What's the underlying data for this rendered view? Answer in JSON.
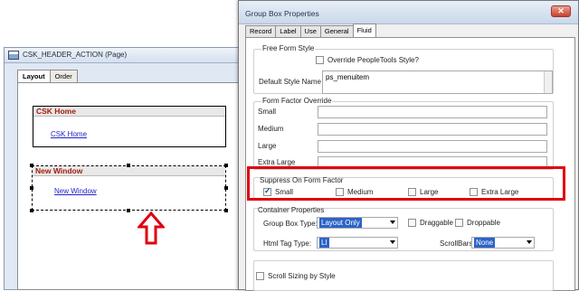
{
  "page_window": {
    "title": "CSK_HEADER_ACTION (Page)",
    "tabs": [
      "Layout",
      "Order"
    ],
    "group_boxes": [
      {
        "header": "CSK Home",
        "link": "CSK Home"
      },
      {
        "header": "New Window",
        "link": "New Window"
      }
    ]
  },
  "dialog": {
    "title": "Group Box Properties",
    "close_label": "✕",
    "tabs": [
      "Record",
      "Label",
      "Use",
      "General",
      "Fluid"
    ],
    "free_form": {
      "legend": "Free Form Style",
      "override_label": "Override PeopleTools Style?",
      "override_checked": false,
      "default_style_label": "Default Style Name",
      "default_style_value": "ps_menuitem"
    },
    "form_factor_override": {
      "legend": "Form Factor Override",
      "fields": [
        "Small",
        "Medium",
        "Large",
        "Extra Large"
      ]
    },
    "suppress": {
      "legend": "Suppress On Form Factor",
      "options": [
        {
          "label": "Small",
          "checked": true
        },
        {
          "label": "Medium",
          "checked": false
        },
        {
          "label": "Large",
          "checked": false
        },
        {
          "label": "Extra Large",
          "checked": false
        }
      ]
    },
    "container": {
      "legend": "Container Properties",
      "group_box_type_label": "Group Box Type:",
      "group_box_type_value": "Layout Only",
      "draggable_label": "Draggable",
      "droppable_label": "Droppable",
      "html_tag_type_label": "Html Tag Type:",
      "html_tag_type_value": "LI",
      "scrollbars_label": "ScrollBars:",
      "scrollbars_value": "None"
    },
    "scroll_sizing_label": "Scroll Sizing by Style"
  },
  "colors": {
    "highlight": "#e0000d",
    "group_header_text": "#a41b0b",
    "link": "#2323c8"
  }
}
